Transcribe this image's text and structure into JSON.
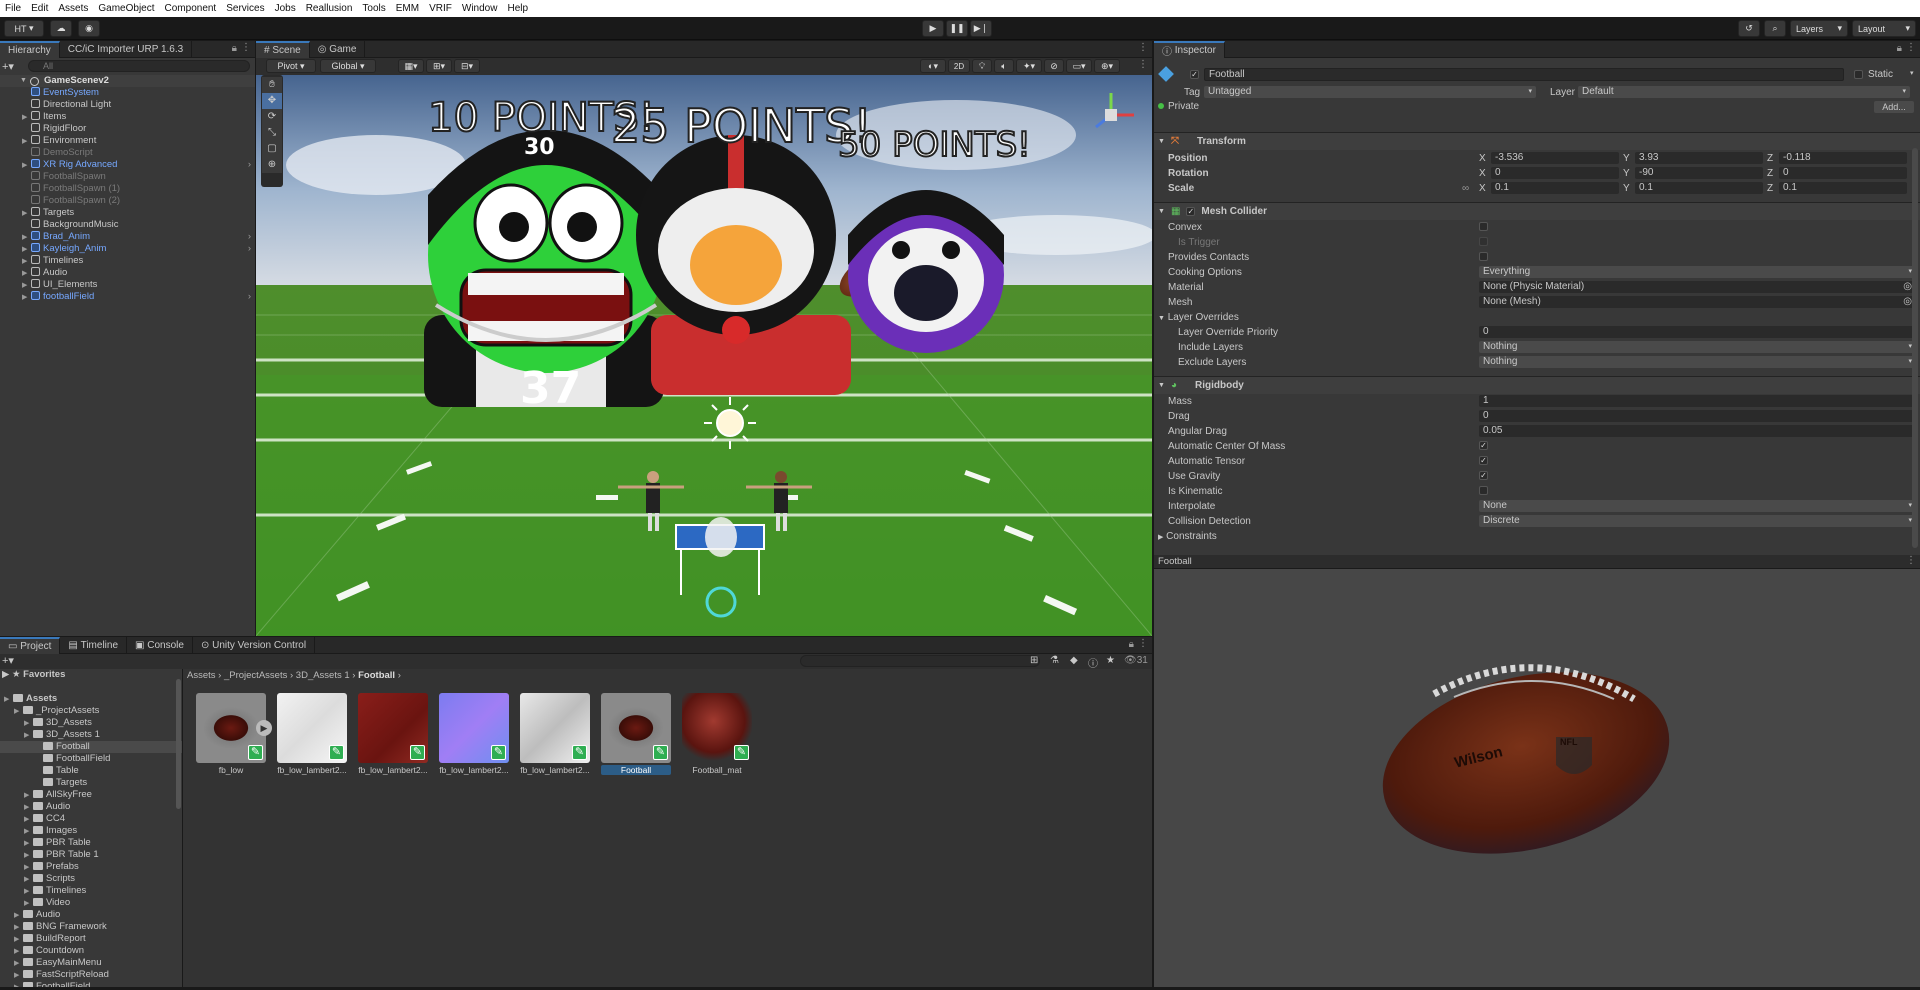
{
  "menu": [
    "File",
    "Edit",
    "Assets",
    "GameObject",
    "Component",
    "Services",
    "Jobs",
    "Reallusion",
    "Tools",
    "EMM",
    "VRIF",
    "Window",
    "Help"
  ],
  "toolbar": {
    "account": "HT",
    "layers": "Layers",
    "layout": "Layout"
  },
  "hierarchy": {
    "tabs": [
      "Hierarchy",
      "CC/iC Importer URP 1.6.3"
    ],
    "search_placeholder": "All",
    "scene": "GameScenev2",
    "items": [
      {
        "label": "EventSystem",
        "style": "blue",
        "arrow": ""
      },
      {
        "label": "Directional Light",
        "style": "",
        "arrow": ""
      },
      {
        "label": "Items",
        "style": "",
        "arrow": "▶"
      },
      {
        "label": "RigidFloor",
        "style": "",
        "arrow": ""
      },
      {
        "label": "Environment",
        "style": "",
        "arrow": "▶"
      },
      {
        "label": "DemoScript",
        "style": "dim",
        "arrow": ""
      },
      {
        "label": "XR Rig Advanced",
        "style": "blue",
        "arrow": "▶"
      },
      {
        "label": "FootballSpawn",
        "style": "dim",
        "arrow": ""
      },
      {
        "label": "FootballSpawn (1)",
        "style": "dim",
        "arrow": ""
      },
      {
        "label": "FootballSpawn (2)",
        "style": "dim",
        "arrow": ""
      },
      {
        "label": "Targets",
        "style": "",
        "arrow": "▶"
      },
      {
        "label": "BackgroundMusic",
        "style": "",
        "arrow": ""
      },
      {
        "label": "Brad_Anim",
        "style": "blue",
        "arrow": "▶"
      },
      {
        "label": "Kayleigh_Anim",
        "style": "blue",
        "arrow": "▶"
      },
      {
        "label": "Timelines",
        "style": "",
        "arrow": "▶"
      },
      {
        "label": "Audio",
        "style": "",
        "arrow": "▶"
      },
      {
        "label": "UI_Elements",
        "style": "",
        "arrow": "▶"
      },
      {
        "label": "footballField",
        "style": "blue",
        "arrow": "▶"
      }
    ]
  },
  "scene_view": {
    "tabs": [
      "Scene",
      "Game"
    ],
    "pivot": "Pivot",
    "global": "Global",
    "mode2d": "2D",
    "signs": [
      "10 POINTS!",
      "25 POINTS!",
      "50 POINTS!"
    ],
    "jersey_number": "37",
    "helmet_number": "30"
  },
  "inspector": {
    "tab": "Inspector",
    "object_name": "Football",
    "static_label": "Static",
    "tag_label": "Tag",
    "tag": "Untagged",
    "layer_label": "Layer",
    "layer": "Default",
    "private_label": "Private",
    "add_label": "Add...",
    "transform": {
      "title": "Transform",
      "rows": [
        {
          "label": "Position",
          "x": "-3.536",
          "y": "3.93",
          "z": "-0.118"
        },
        {
          "label": "Rotation",
          "x": "0",
          "y": "-90",
          "z": "0"
        },
        {
          "label": "Scale",
          "x": "0.1",
          "y": "0.1",
          "z": "0.1"
        }
      ]
    },
    "mesh_collider": {
      "title": "Mesh Collider",
      "convex": "Convex",
      "is_trigger": "Is Trigger",
      "provides_contacts": "Provides Contacts",
      "cooking_label": "Cooking Options",
      "cooking": "Everything",
      "material_label": "Material",
      "material": "None (Physic Material)",
      "mesh_label": "Mesh",
      "mesh": "None (Mesh)",
      "layer_overrides": "Layer Overrides",
      "priority_label": "Layer Override Priority",
      "priority": "0",
      "include_label": "Include Layers",
      "include": "Nothing",
      "exclude_label": "Exclude Layers",
      "exclude": "Nothing"
    },
    "rigidbody": {
      "title": "Rigidbody",
      "mass_label": "Mass",
      "mass": "1",
      "drag_label": "Drag",
      "drag": "0",
      "angular_label": "Angular Drag",
      "angular": "0.05",
      "auto_com": "Automatic Center Of Mass",
      "auto_tensor": "Automatic Tensor",
      "use_gravity": "Use Gravity",
      "is_kinematic": "Is Kinematic",
      "interp_label": "Interpolate",
      "interp": "None",
      "coll_label": "Collision Detection",
      "coll": "Discrete",
      "constraints": "Constraints"
    },
    "preview_title": "Football",
    "ball_brand": "Wilson",
    "ball_logo": "NFL"
  },
  "project": {
    "tabs": [
      "Project",
      "Timeline",
      "Console",
      "Unity Version Control"
    ],
    "count": "31",
    "favorites": "Favorites",
    "tree": [
      {
        "label": "Assets",
        "depth": 0,
        "bold": true
      },
      {
        "label": "_ProjectAssets",
        "depth": 1
      },
      {
        "label": "3D_Assets",
        "depth": 2
      },
      {
        "label": "3D_Assets 1",
        "depth": 2
      },
      {
        "label": "Football",
        "depth": 3,
        "selected": true
      },
      {
        "label": "FootballField",
        "depth": 3
      },
      {
        "label": "Table",
        "depth": 3
      },
      {
        "label": "Targets",
        "depth": 3
      },
      {
        "label": "AllSkyFree",
        "depth": 2
      },
      {
        "label": "Audio",
        "depth": 2
      },
      {
        "label": "CC4",
        "depth": 2
      },
      {
        "label": "Images",
        "depth": 2
      },
      {
        "label": "PBR Table",
        "depth": 2
      },
      {
        "label": "PBR Table 1",
        "depth": 2
      },
      {
        "label": "Prefabs",
        "depth": 2
      },
      {
        "label": "Scripts",
        "depth": 2
      },
      {
        "label": "Timelines",
        "depth": 2
      },
      {
        "label": "Video",
        "depth": 2
      },
      {
        "label": "Audio",
        "depth": 1
      },
      {
        "label": "BNG Framework",
        "depth": 1
      },
      {
        "label": "BuildReport",
        "depth": 1
      },
      {
        "label": "Countdown",
        "depth": 1
      },
      {
        "label": "EasyMainMenu",
        "depth": 1
      },
      {
        "label": "FastScriptReload",
        "depth": 1
      },
      {
        "label": "FootballField",
        "depth": 1
      }
    ],
    "breadcrumb": [
      "Assets",
      "_ProjectAssets",
      "3D_Assets 1",
      "Football"
    ],
    "assets": [
      {
        "name": "fb_low",
        "kind": "ball"
      },
      {
        "name": "fb_low_lambert2...",
        "kind": "white"
      },
      {
        "name": "fb_low_lambert2...",
        "kind": "red"
      },
      {
        "name": "fb_low_lambert2...",
        "kind": "normal"
      },
      {
        "name": "fb_low_lambert2...",
        "kind": "gray"
      },
      {
        "name": "Football",
        "kind": "ball",
        "selected": true
      },
      {
        "name": "Football_mat",
        "kind": "sphere"
      }
    ]
  }
}
